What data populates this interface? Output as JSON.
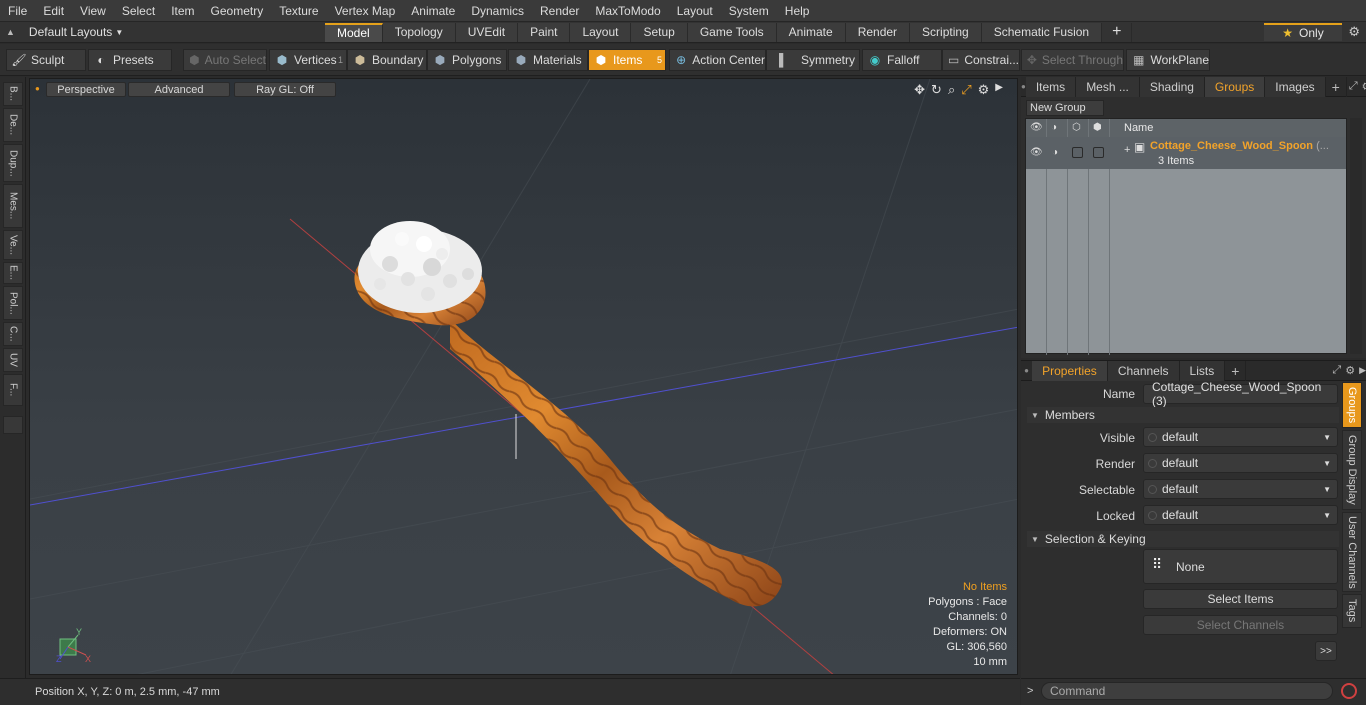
{
  "menubar": [
    "File",
    "Edit",
    "View",
    "Select",
    "Item",
    "Geometry",
    "Texture",
    "Vertex Map",
    "Animate",
    "Dynamics",
    "Render",
    "MaxToModo",
    "Layout",
    "System",
    "Help"
  ],
  "layouts": {
    "selector": "Default Layouts",
    "tabs": [
      "Model",
      "Topology",
      "UVEdit",
      "Paint",
      "Layout",
      "Setup",
      "Game Tools",
      "Animate",
      "Render",
      "Scripting",
      "Schematic Fusion"
    ],
    "active": "Model",
    "only_label": "Only"
  },
  "toolbar": {
    "sculpt": "Sculpt",
    "presets": "Presets",
    "auto_select": "Auto Select",
    "vertices": "Vertices",
    "vertices_count": "1",
    "boundary": "Boundary",
    "polygons": "Polygons",
    "materials": "Materials",
    "items": "Items",
    "items_count": "5",
    "action_center": "Action Center",
    "symmetry": "Symmetry",
    "falloff": "Falloff",
    "constraints": "Constrai...",
    "select_through": "Select Through",
    "workplane": "WorkPlane"
  },
  "left_tabs": [
    "B...",
    "De...",
    "Dup...",
    "Mes...",
    "Ve...",
    "E...",
    "Pol...",
    "C...",
    "UV",
    "F..."
  ],
  "viewport": {
    "view_mode": "Perspective",
    "shading": "Advanced",
    "raygl": "Ray GL: Off",
    "info": {
      "items": "No Items",
      "polygons": "Polygons : Face",
      "channels": "Channels: 0",
      "deformers": "Deformers: ON",
      "gl": "GL: 306,560",
      "scale": "10 mm"
    },
    "axis_labels": {
      "x": "X",
      "y": "Y",
      "z": "Z"
    }
  },
  "status": {
    "position": "Position X, Y, Z:   0 m, 2.5 mm, -47 mm"
  },
  "top_panel": {
    "tabs": [
      "Items",
      "Mesh ...",
      "Shading",
      "Groups",
      "Images"
    ],
    "active": "Groups",
    "new_group": "New Group",
    "column_name": "Name",
    "group": {
      "name": "Cottage_Cheese_Wood_Spoon",
      "suffix": "(...",
      "items": "3 Items"
    }
  },
  "props_panel": {
    "tabs": [
      "Properties",
      "Channels",
      "Lists"
    ],
    "active": "Properties",
    "name_label": "Name",
    "name_value": "Cottage_Cheese_Wood_Spoon (3)",
    "members_section": "Members",
    "fields": [
      {
        "label": "Visible",
        "value": "default"
      },
      {
        "label": "Render",
        "value": "default"
      },
      {
        "label": "Selectable",
        "value": "default"
      },
      {
        "label": "Locked",
        "value": "default"
      }
    ],
    "keying_section": "Selection & Keying",
    "none_label": "None",
    "select_items": "Select Items",
    "select_channels": "Select Channels",
    "more": ">>",
    "side_tabs": [
      "Groups",
      "Group Display",
      "User Channels",
      "Tags"
    ]
  },
  "command": {
    "prompt": ">",
    "placeholder": "Command"
  },
  "colors": {
    "accent": "#e8981c",
    "group_name": "#f2a32a",
    "info_warning": "#f0a020"
  }
}
